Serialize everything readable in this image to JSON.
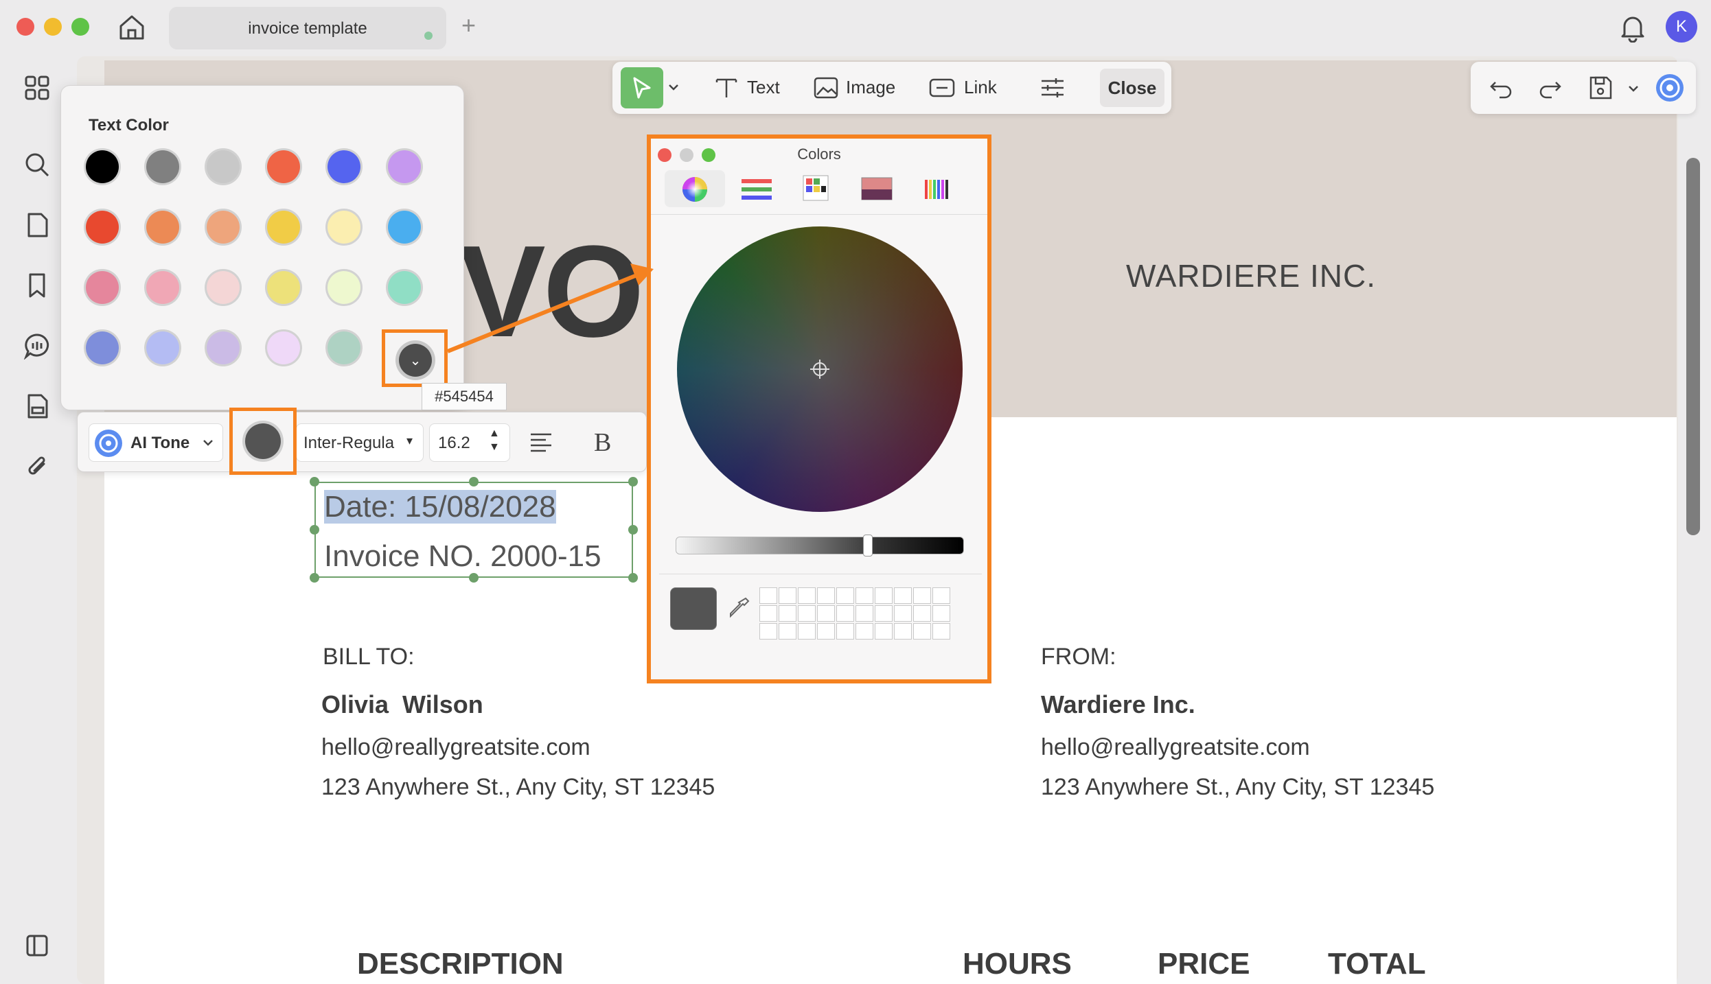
{
  "window": {
    "tab_title": "invoice template",
    "new_tab": "+",
    "avatar_initial": "K"
  },
  "toolbar": {
    "text_label": "Text",
    "image_label": "Image",
    "link_label": "Link",
    "close_label": "Close"
  },
  "text_color_panel": {
    "title": "Text Color",
    "swatches": [
      [
        "#000000",
        "#808080",
        "#c8c8c8",
        "#ef6445",
        "#5564ef",
        "#c598ef"
      ],
      [
        "#e8492f",
        "#ec8a55",
        "#eea57c",
        "#f1cc46",
        "#fbeeb0",
        "#4aaeef"
      ],
      [
        "#e5869c",
        "#f0a7b5",
        "#f4d6d6",
        "#ede17a",
        "#eef8cf",
        "#90dec5"
      ],
      [
        "#7e8edb",
        "#b4bcf3",
        "#cbbbe6",
        "#efd9f8",
        "#aed2c3"
      ]
    ],
    "hex_tooltip": "#545454"
  },
  "format_bar": {
    "ai_tone_label": "AI Tone",
    "current_color": "#545454",
    "font_name": "Inter-Regula",
    "font_size": "16.2"
  },
  "colors_window": {
    "title": "Colors",
    "current_color": "#545454"
  },
  "document": {
    "header_company": "WARDIERE INC.",
    "big_title_fragment": "VOI",
    "date_line": "Date: 15/08/2028",
    "invoice_line": "Invoice NO. 2000-15",
    "bill_to": {
      "label": "BILL TO:",
      "name": "Olivia  Wilson",
      "email": "hello@reallygreatsite.com",
      "address": "123 Anywhere St., Any City, ST 12345"
    },
    "from": {
      "label": "FROM:",
      "name": "Wardiere Inc.",
      "email": "hello@reallygreatsite.com",
      "address": "123 Anywhere St., Any City, ST 12345"
    },
    "columns": [
      "DESCRIPTION",
      "HOURS",
      "PRICE",
      "TOTAL"
    ]
  },
  "colors": {
    "accent_orange": "#f58220",
    "select_green": "#6dbd6a"
  }
}
